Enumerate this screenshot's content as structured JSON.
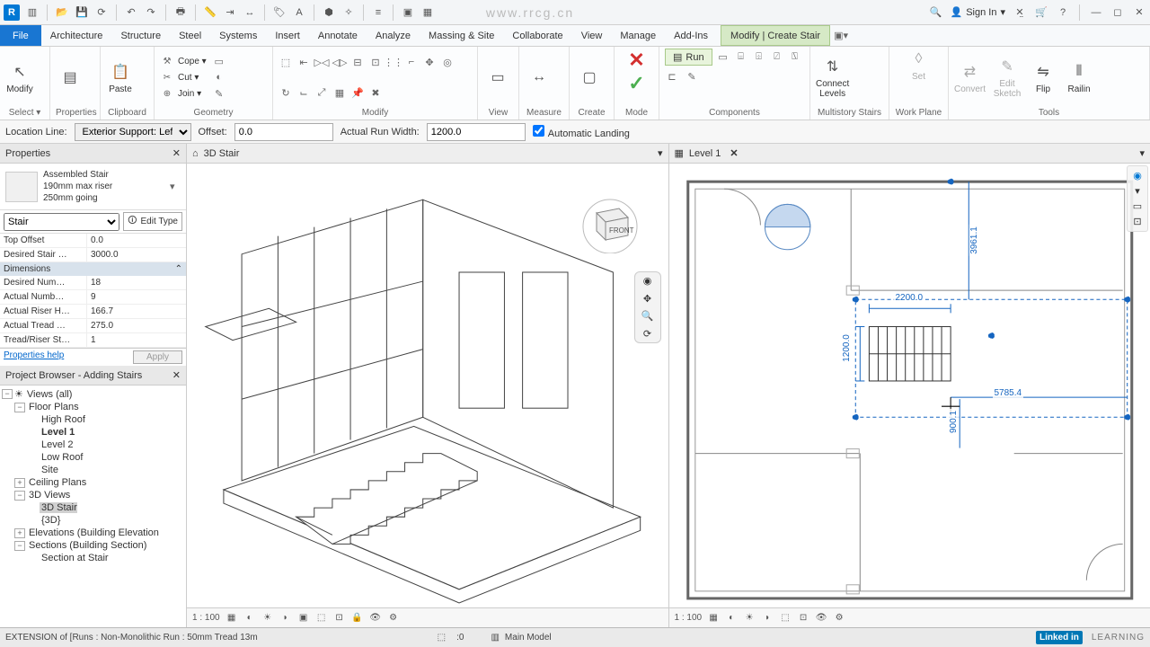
{
  "qat": {
    "signin": "Sign In",
    "watermark": "www.rrcg.cn"
  },
  "tabs": [
    "File",
    "Architecture",
    "Structure",
    "Steel",
    "Systems",
    "Insert",
    "Annotate",
    "Analyze",
    "Massing & Site",
    "Collaborate",
    "View",
    "Manage",
    "Add-Ins"
  ],
  "ctx_tab": "Modify | Create Stair",
  "ribbon": {
    "modify": "Modify",
    "select": "Select ▾",
    "properties": "Properties",
    "paste": "Paste",
    "clipboard": "Clipboard",
    "cope": "Cope ▾",
    "cut": "Cut ▾",
    "join": "Join ▾",
    "geometry": "Geometry",
    "modify_grp": "Modify",
    "view": "View",
    "measure": "Measure",
    "create": "Create",
    "mode": "Mode",
    "run": "Run",
    "components": "Components",
    "connect": "Connect\nLevels",
    "multistory": "Multistory Stairs",
    "set": "Set",
    "workplane": "Work Plane",
    "convert": "Convert",
    "editsketch": "Edit\nSketch",
    "flip": "Flip",
    "railing": "Railin",
    "tools": "Tools"
  },
  "options": {
    "loc_label": "Location Line:",
    "loc_val": "Exterior Support: Left",
    "offset_label": "Offset:",
    "offset_val": "0.0",
    "width_label": "Actual Run Width:",
    "width_val": "1200.0",
    "auto_landing": "Automatic Landing"
  },
  "props": {
    "title": "Properties",
    "type_name": "Assembled Stair",
    "type_desc1": "190mm max riser",
    "type_desc2": "250mm going",
    "filter": "Stair",
    "edit_type": "Edit Type",
    "group_constraints_hidden": true,
    "rows_top": [
      {
        "k": "Top Offset",
        "v": "0.0"
      },
      {
        "k": "Desired Stair …",
        "v": "3000.0"
      }
    ],
    "group_dim": "Dimensions",
    "rows_dim": [
      {
        "k": "Desired Num…",
        "v": "18"
      },
      {
        "k": "Actual Numb…",
        "v": "9"
      },
      {
        "k": "Actual Riser H…",
        "v": "166.7"
      },
      {
        "k": "Actual Tread …",
        "v": "275.0"
      },
      {
        "k": "Tread/Riser St…",
        "v": "1"
      }
    ],
    "help": "Properties help",
    "apply": "Apply"
  },
  "browser": {
    "title": "Project Browser - Adding Stairs",
    "views": "Views (all)",
    "floor_plans": "Floor Plans",
    "fp": [
      "High Roof",
      "Level 1",
      "Level 2",
      "Low Roof",
      "Site"
    ],
    "ceiling": "Ceiling Plans",
    "v3d": "3D Views",
    "v3d_items": [
      "3D Stair",
      "{3D}"
    ],
    "elev": "Elevations (Building Elevation",
    "sect": "Sections (Building Section)",
    "sect_item": "Section at Stair"
  },
  "view3d": {
    "tab": "3D Stair",
    "cube": "FRONT",
    "scale": "1 : 100"
  },
  "viewplan": {
    "tab": "Level 1",
    "scale": "1 : 100",
    "dims": {
      "w": "2200.0",
      "h": "1200.0",
      "ext": "5785.4",
      "side": "3961.1",
      "below": "900.1"
    }
  },
  "status": {
    "left": "EXTENSION  of [Runs : Non-Monolithic Run : 50mm Tread 13m",
    "zero": ":0",
    "model": "Main Model",
    "brand1": "Linked in",
    "brand2": "LEARNING"
  }
}
